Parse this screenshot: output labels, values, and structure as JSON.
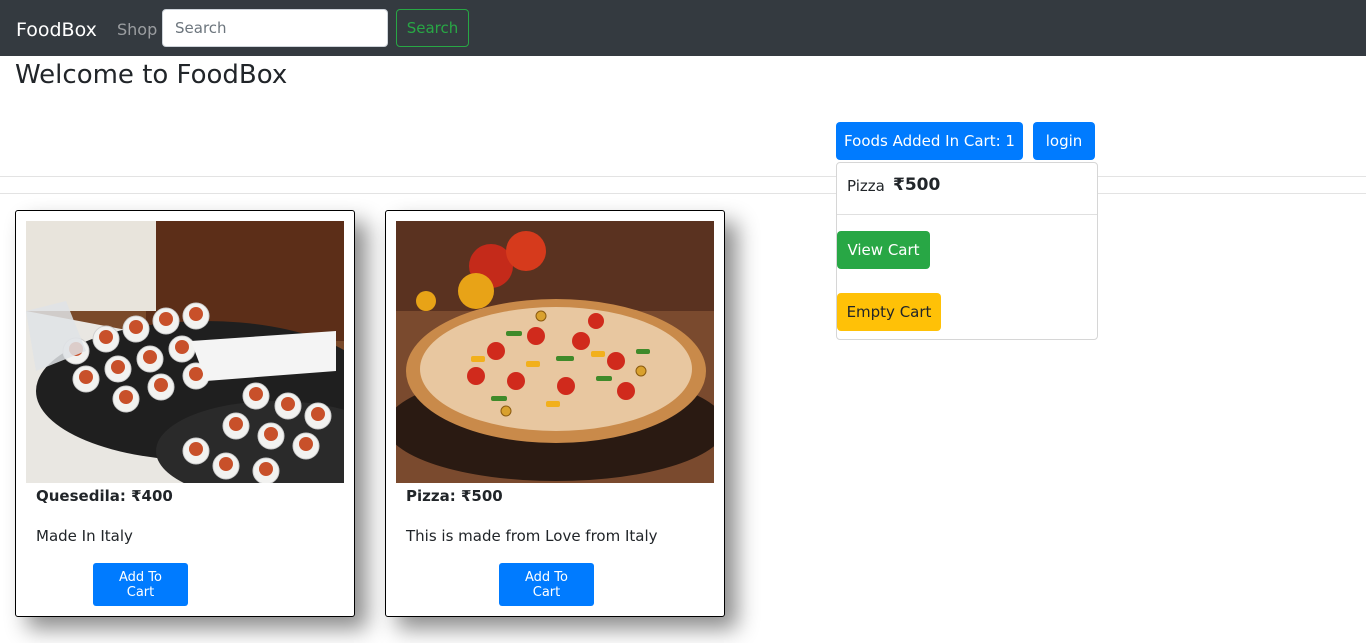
{
  "navbar": {
    "brand": "FoodBox",
    "shop_link": "Shop",
    "search_placeholder": "Search",
    "search_button": "Search"
  },
  "page": {
    "heading": "Welcome to FoodBox"
  },
  "cart": {
    "button_label": "Foods Added In Cart: 1",
    "login_label": "login",
    "items": [
      {
        "name": "Pizza",
        "price": "₹500"
      }
    ],
    "view_cart_label": "View Cart",
    "empty_cart_label": "Empty Cart"
  },
  "products": [
    {
      "title": "Quesedila: ₹400",
      "description": "Made In Italy",
      "button_label": "Add To Cart",
      "image_icon": "quesadilla-photo"
    },
    {
      "title": "Pizza: ₹500",
      "description": "This is made from Love from Italy",
      "button_label": "Add To Cart",
      "image_icon": "pizza-photo"
    }
  ],
  "colors": {
    "navbar_bg": "#343a40",
    "primary": "#007bff",
    "success": "#28a745",
    "warning": "#ffc107"
  }
}
